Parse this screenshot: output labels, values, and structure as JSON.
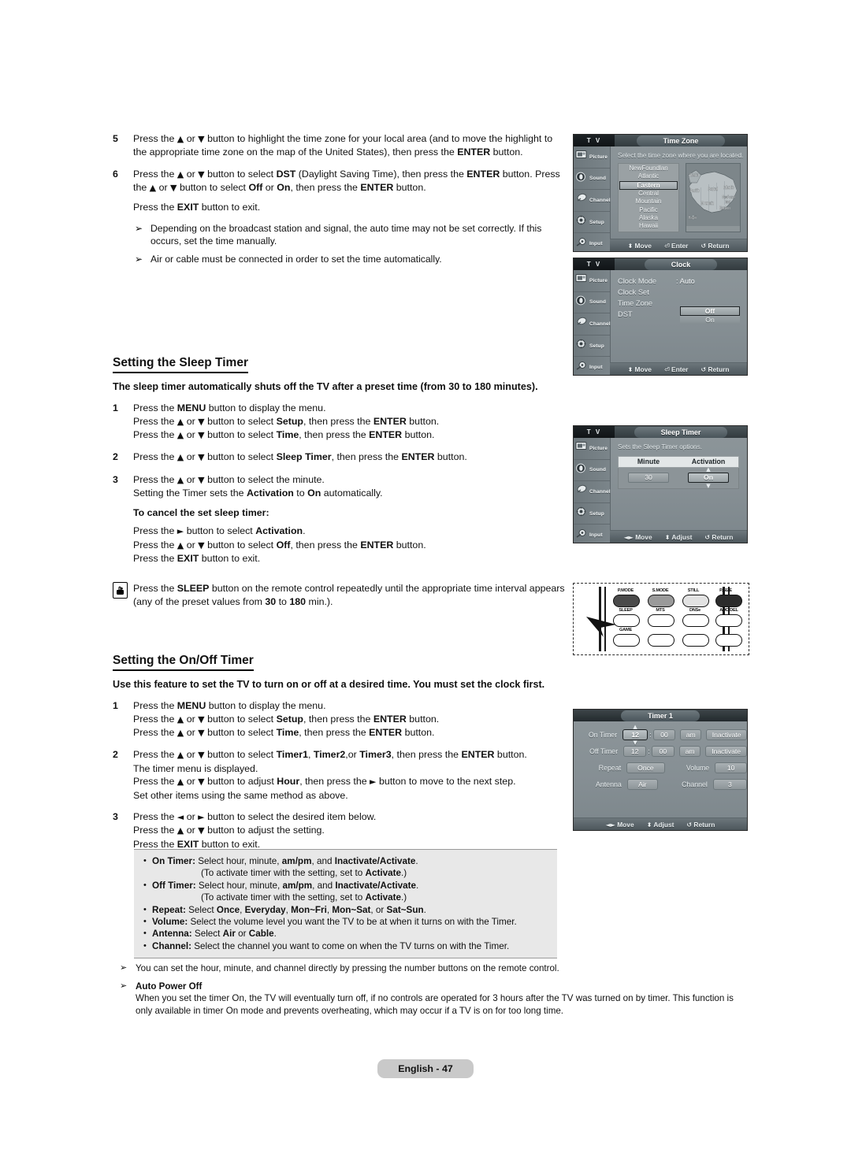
{
  "left_column": {
    "steps": [
      {
        "num": "5",
        "lines": [
          "Press the ▲ or ▼ button to highlight the time zone for your local area (and to move the highlight to the appropriate time zone on the map of the United States), then press the ENTER button."
        ]
      },
      {
        "num": "6",
        "lines": [
          "Press the ▲ or ▼ button to select DST (Daylight Saving Time), then press the ENTER button. Press the ▲ or ▼ button to select Off or On, then press the ENTER button.",
          "Press the EXIT button to exit."
        ]
      }
    ],
    "notes": [
      "Depending on the broadcast station and signal, the auto time may not be set correctly. If this occurs, set the time manually.",
      "Air or cable must be connected in order to set the time automatically."
    ]
  },
  "sleep_section": {
    "heading": "Setting the Sleep Timer",
    "subheading": "The sleep timer automatically shuts off the TV after a preset time (from 30 to 180 minutes).",
    "steps": [
      {
        "num": "1",
        "lines": [
          "Press the MENU button to display the menu.",
          "Press the ▲ or ▼ button to select Setup, then press the ENTER button.",
          "Press the ▲ or ▼ button to select Time, then press the ENTER button."
        ]
      },
      {
        "num": "2",
        "lines": [
          "Press the ▲ or ▼ button to select Sleep Timer, then press the ENTER button."
        ]
      },
      {
        "num": "3",
        "lines": [
          "Press the ▲ or ▼ button to select the minute.",
          "Setting the Timer sets the Activation to On automatically."
        ]
      }
    ],
    "cancel_heading": "To cancel the set sleep timer:",
    "cancel_lines": [
      "Press the ► button to select Activation.",
      "Press the ▲ or ▼ button to select Off, then press the ENTER button.",
      "Press the EXIT button to exit."
    ],
    "remote_note": "Press the SLEEP button on the remote control repeatedly until the appropriate time interval appears (any of the preset values from 30 to 180 min.)."
  },
  "onoff_section": {
    "heading": "Setting the On/Off Timer",
    "subheading": "Use this feature to set the TV to turn on or off at a desired time. You must set the clock first.",
    "steps": [
      {
        "num": "1",
        "lines": [
          "Press the MENU button to display the menu.",
          "Press the ▲ or ▼ button to select Setup, then press the ENTER button.",
          "Press the ▲ or ▼ button to select Time, then press the ENTER button."
        ]
      },
      {
        "num": "2",
        "lines": [
          "Press the ▲ or ▼ button to select Timer1, Timer2,or Timer3, then press the ENTER button.",
          "The timer menu is displayed.",
          "Press the ▲ or ▼ button to adjust Hour, then press the ► button to move to the next step.",
          "Set other items using the same method as above."
        ]
      },
      {
        "num": "3",
        "lines": [
          "Press the ◄ or ► button to select the desired item below.",
          "Press the ▲ or ▼ button to adjust the setting.",
          "Press the EXIT button to exit."
        ]
      }
    ]
  },
  "info_box": {
    "rows": [
      {
        "bullet": "•",
        "label": "On Timer:",
        "text": " Select hour, minute, am/pm, and Inactivate/Activate."
      },
      {
        "indent": "(To activate timer with the setting, set to Activate.)"
      },
      {
        "bullet": "•",
        "label": "Off Timer:",
        "text": " Select hour, minute, am/pm, and Inactivate/Activate."
      },
      {
        "indent": "(To activate timer with the setting, set to Activate.)"
      },
      {
        "bullet": "•",
        "label": "Repeat:",
        "text": " Select Once, Everyday, Mon~Fri, Mon~Sat, or Sat~Sun."
      },
      {
        "bullet": "•",
        "label": "Volume:",
        "text": " Select the volume level you want the TV to be at when it turns on with the Timer."
      },
      {
        "bullet": "•",
        "label": "Antenna:",
        "text": " Select Air or Cable."
      },
      {
        "bullet": "•",
        "label": "Channel:",
        "text": " Select the channel you want to come on when the TV turns on with the Timer."
      }
    ]
  },
  "bottom_notes": [
    {
      "title": "",
      "text": "You can set the hour, minute, and channel directly by pressing the number buttons on the remote control."
    },
    {
      "title": "Auto Power Off",
      "text": "When you set the timer On, the TV will eventually turn off, if no controls are operated for 3 hours after the TV was turned on by timer. This function is only available in timer On mode and prevents overheating, which may occur if a TV is on for too long time."
    }
  ],
  "footer": {
    "page_label": "English - 47"
  },
  "osd": {
    "sidebar_items": [
      {
        "label": "Picture",
        "icon": "picture-icon"
      },
      {
        "label": "Sound",
        "icon": "sound-icon"
      },
      {
        "label": "Channel",
        "icon": "channel-icon"
      },
      {
        "label": "Setup",
        "icon": "setup-icon"
      },
      {
        "label": "Input",
        "icon": "input-icon"
      }
    ],
    "tv_tab": "T V",
    "time_zone": {
      "title": "Time Zone",
      "description": "Select the time zone where you are located.",
      "options": [
        "NewFoundlan",
        "Atlantic",
        "Eastern",
        "Central",
        "Mountain",
        "Pacific",
        "Alaska",
        "Hawaii"
      ],
      "selected": "Eastern",
      "map_labels": [
        "Alaska",
        "Pacific",
        "Central",
        "Atlantic",
        "NewFoundland",
        "Mountain",
        "Eastern",
        "Hawaii"
      ],
      "footer": [
        {
          "glyph": "⬍",
          "label": "Move"
        },
        {
          "glyph": "⏎",
          "label": "Enter"
        },
        {
          "glyph": "↺",
          "label": "Return"
        }
      ]
    },
    "clock": {
      "title": "Clock",
      "rows": [
        {
          "label": "Clock Mode",
          "value": ": Auto"
        },
        {
          "label": "Clock Set",
          "value": ""
        },
        {
          "label": "Time Zone",
          "value": ""
        },
        {
          "label": "DST",
          "value": ""
        }
      ],
      "dst_options": [
        "Off",
        "On"
      ],
      "dst_selected": "Off",
      "footer": [
        {
          "glyph": "⬍",
          "label": "Move"
        },
        {
          "glyph": "⏎",
          "label": "Enter"
        },
        {
          "glyph": "↺",
          "label": "Return"
        }
      ]
    },
    "sleep_timer": {
      "title": "Sleep Timer",
      "description": "Sets the Sleep Timer options.",
      "columns": [
        "Minute",
        "Activation"
      ],
      "values": [
        "30",
        "On"
      ],
      "selected_column": "Activation",
      "footer": [
        {
          "glyph": "◄►",
          "label": "Move"
        },
        {
          "glyph": "⬍",
          "label": "Adjust"
        },
        {
          "glyph": "↺",
          "label": "Return"
        }
      ]
    },
    "timer1": {
      "title": "Timer 1",
      "rows": [
        {
          "label": "On Timer",
          "hour": "12",
          "minute": "00",
          "ampm": "am",
          "state": "Inactivate",
          "selected": "hour"
        },
        {
          "label": "Off Timer",
          "hour": "12",
          "minute": "00",
          "ampm": "am",
          "state": "Inactivate",
          "selected": ""
        }
      ],
      "repeat_label": "Repeat",
      "repeat_value": "Once",
      "volume_label": "Volume",
      "volume_value": "10",
      "antenna_label": "Antenna",
      "antenna_value": "Air",
      "channel_label": "Channel",
      "channel_value": "3",
      "footer": [
        {
          "glyph": "◄►",
          "label": "Move"
        },
        {
          "glyph": "⬍",
          "label": "Adjust"
        },
        {
          "glyph": "↺",
          "label": "Return"
        }
      ]
    }
  },
  "remote": {
    "row1": [
      "P.MODE",
      "S.MODE",
      "STILL",
      "P.SIZE"
    ],
    "row2": [
      "SLEEP",
      "MTS",
      "DNSe",
      "ADD/DEL"
    ],
    "row3": [
      "GAME",
      "",
      "",
      ""
    ],
    "highlight": "SLEEP"
  }
}
